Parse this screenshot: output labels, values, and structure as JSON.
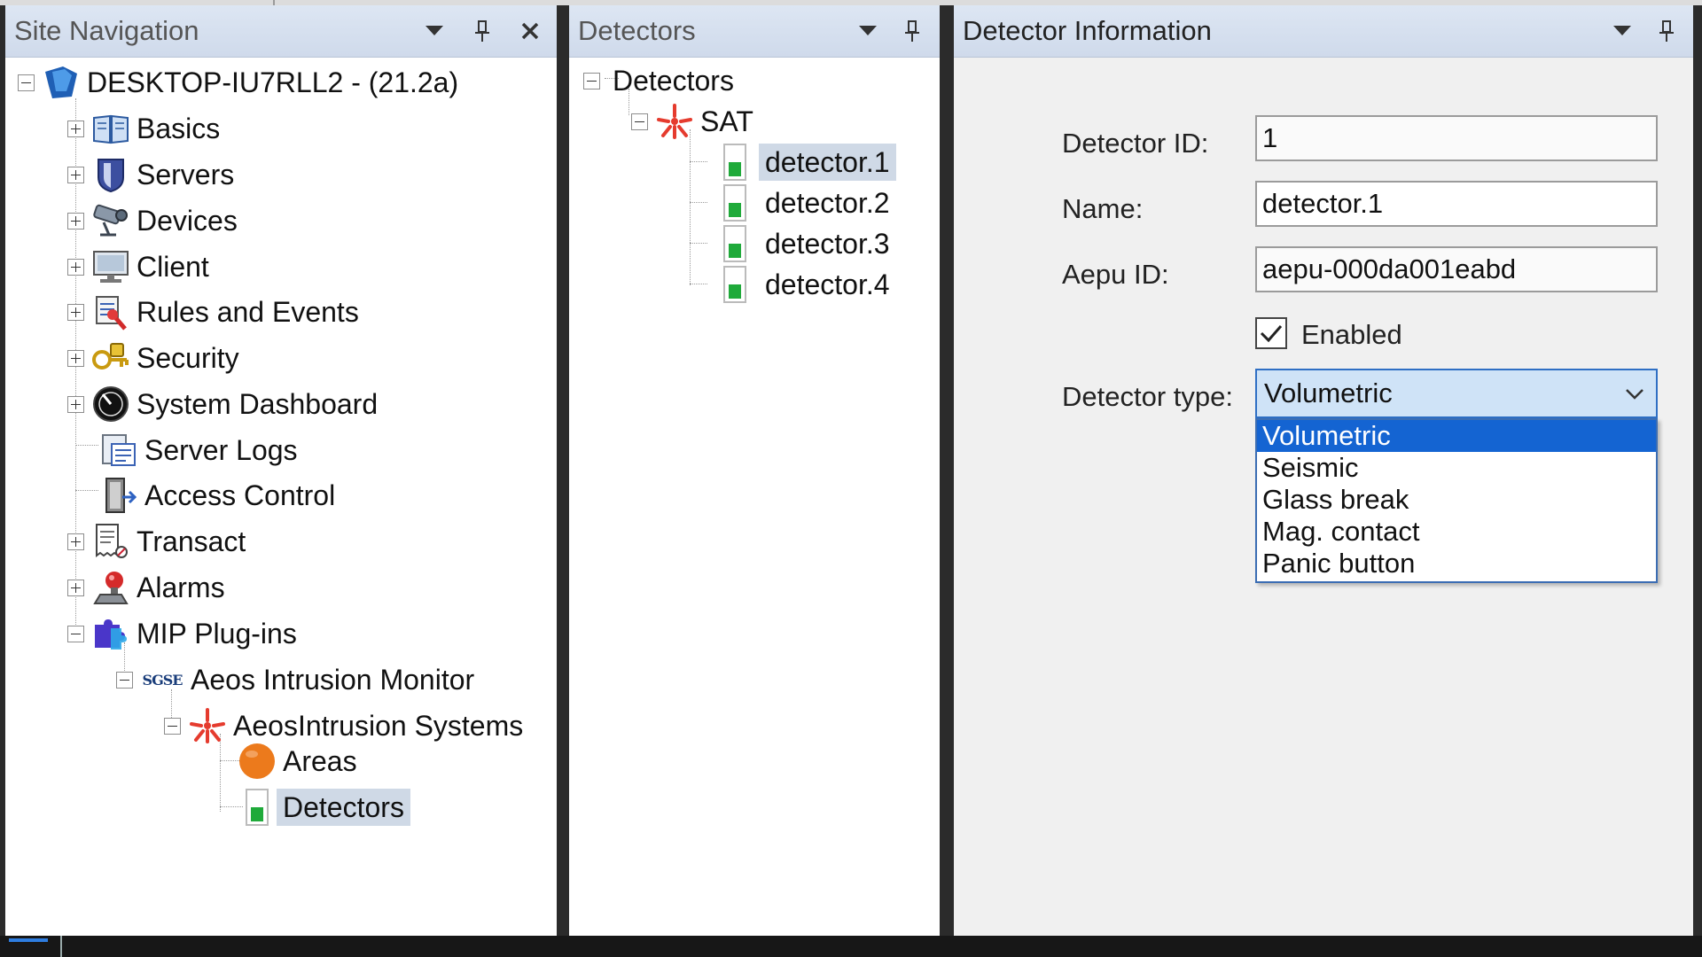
{
  "site_navigation": {
    "title": "Site Navigation",
    "root": "DESKTOP-IU7RLL2 - (21.2a)",
    "items": [
      {
        "label": "Basics",
        "icon": "book-icon"
      },
      {
        "label": "Servers",
        "icon": "server-shield-icon"
      },
      {
        "label": "Devices",
        "icon": "camera-icon"
      },
      {
        "label": "Client",
        "icon": "monitor-icon"
      },
      {
        "label": "Rules and Events",
        "icon": "rules-icon"
      },
      {
        "label": "Security",
        "icon": "keys-icon"
      },
      {
        "label": "System Dashboard",
        "icon": "gauge-icon"
      },
      {
        "label": "Server Logs",
        "icon": "log-icon"
      },
      {
        "label": "Access Control",
        "icon": "door-icon"
      },
      {
        "label": "Transact",
        "icon": "receipt-icon"
      },
      {
        "label": "Alarms",
        "icon": "siren-icon"
      },
      {
        "label": "MIP Plug-ins",
        "icon": "puzzle-icon"
      }
    ],
    "plugin": {
      "label": "Aeos Intrusion Monitor",
      "logo": "SGSE"
    },
    "system": {
      "label": "AeosIntrusion Systems",
      "icon": "star-burst-icon"
    },
    "areas": {
      "label": "Areas",
      "icon": "orange-circle-icon"
    },
    "detectors": {
      "label": "Detectors",
      "icon": "detector-icon"
    }
  },
  "detectors_panel": {
    "title": "Detectors",
    "root": "Detectors",
    "group": "SAT",
    "items": [
      "detector.1",
      "detector.2",
      "detector.3",
      "detector.4"
    ],
    "selected": "detector.1"
  },
  "detector_info": {
    "title": "Detector Information",
    "detector_id_label": "Detector ID:",
    "detector_id_value": "1",
    "name_label": "Name:",
    "name_value": "detector.1",
    "aepu_id_label": "Aepu ID:",
    "aepu_id_value": "aepu-000da001eabd",
    "enabled_label": "Enabled",
    "enabled": true,
    "type_label": "Detector type:",
    "type_value": "Volumetric",
    "type_options": [
      "Volumetric",
      "Seismic",
      "Glass break",
      "Mag. contact",
      "Panic button"
    ],
    "highlighted_option": "Volumetric"
  },
  "colors": {
    "header_bg": "#cfdaeb",
    "selection": "#cfd9e6",
    "dropdown_highlight": "#1464d2",
    "detector_green": "#1faa3a",
    "star_red": "#e53b2e",
    "areas_orange": "#ec7a1c"
  }
}
